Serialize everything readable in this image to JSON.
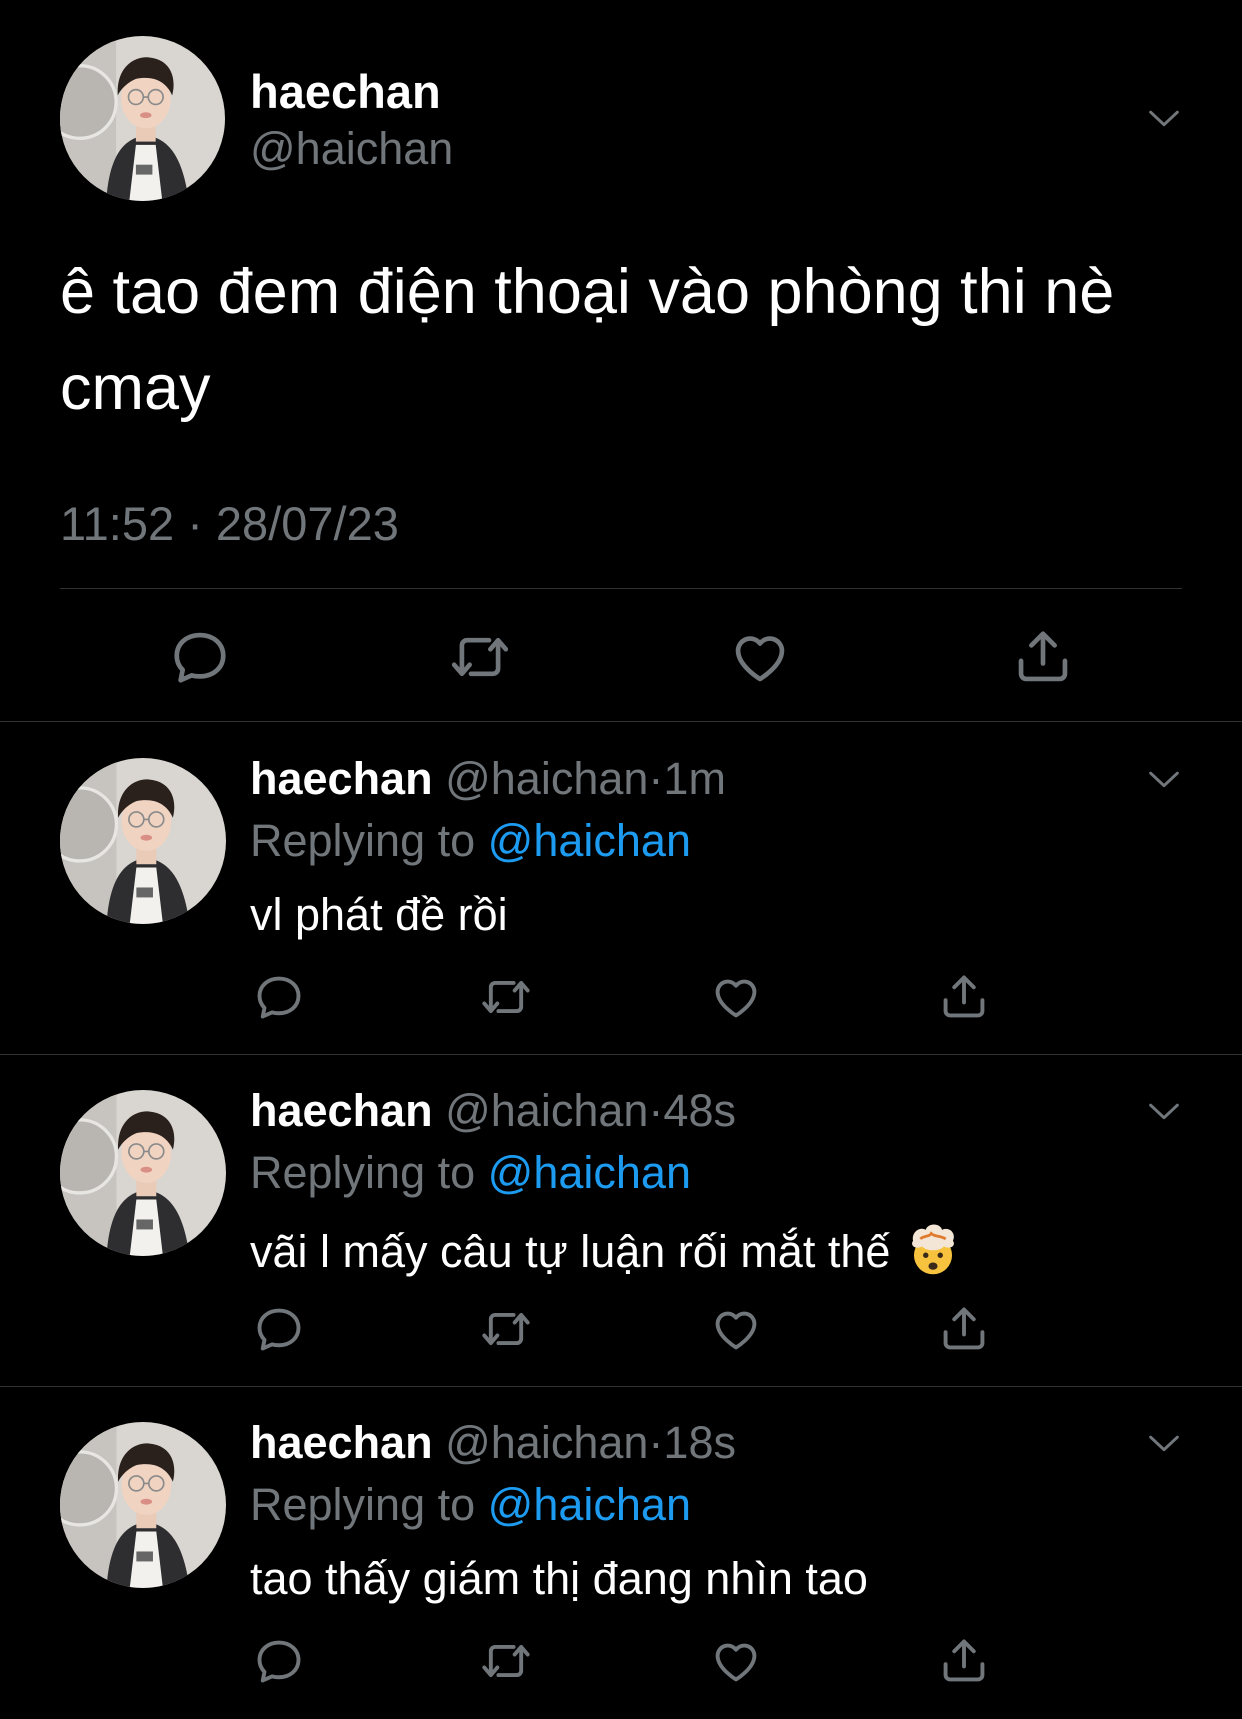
{
  "main_tweet": {
    "display_name": "haechan",
    "handle": "@haichan",
    "text": "ê tao đem điện thoại vào phòng thi nè cmay",
    "time": "11:52",
    "separator": "·",
    "date": "28/07/23",
    "icons": [
      "reply-icon",
      "retweet-icon",
      "like-icon",
      "share-icon",
      "chevron-down-icon"
    ]
  },
  "replies": [
    {
      "display_name": "haechan",
      "handle": "@haichan",
      "separator": "·",
      "time": "1m",
      "replying_prefix": "Replying to",
      "replying_to": "@haichan",
      "text": "vl phát đề rồi"
    },
    {
      "display_name": "haechan",
      "handle": "@haichan",
      "separator": "·",
      "time": "48s",
      "replying_prefix": "Replying to",
      "replying_to": "@haichan",
      "text": "vãi l mấy câu tự luận rối mắt thế",
      "emoji": "exploding-head-emoji"
    },
    {
      "display_name": "haechan",
      "handle": "@haichan",
      "separator": "·",
      "time": "18s",
      "replying_prefix": "Replying to",
      "replying_to": "@haichan",
      "text": "tao thấy giám thị đang nhìn tao"
    }
  ],
  "colors": {
    "background": "#000000",
    "text_primary": "#ffffff",
    "text_secondary": "#71767b",
    "link": "#1d9bf0",
    "divider": "#2f3336"
  }
}
